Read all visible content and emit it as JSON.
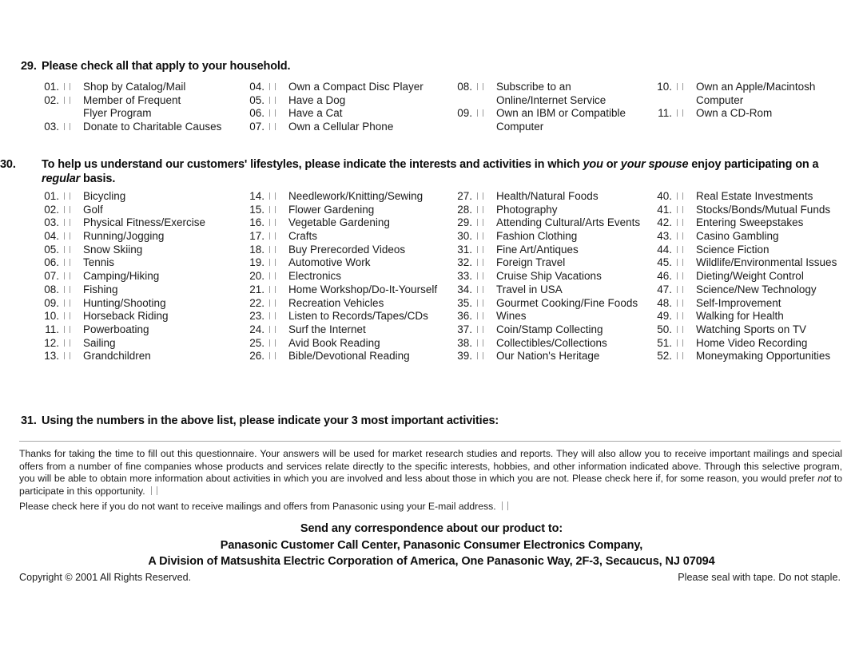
{
  "document": {
    "q29": {
      "number": "29.",
      "heading": "Please check all that apply to your household.",
      "columns": [
        {
          "items": [
            {
              "num": "01.",
              "label": "Shop by Catalog/Mail"
            },
            {
              "num": "02.",
              "label": "Member of Frequent"
            },
            {
              "num": "",
              "label": "Flyer Program",
              "continuation": true
            },
            {
              "num": "03.",
              "label": "Donate to Charitable Causes"
            }
          ]
        },
        {
          "items": [
            {
              "num": "04.",
              "label": "Own a Compact Disc Player"
            },
            {
              "num": "05.",
              "label": "Have a Dog"
            },
            {
              "num": "06.",
              "label": "Have a Cat"
            },
            {
              "num": "07.",
              "label": "Own a Cellular Phone"
            }
          ]
        },
        {
          "items": [
            {
              "num": "08.",
              "label": "Subscribe to an"
            },
            {
              "num": "",
              "label": "Online/Internet Service",
              "continuation": true
            },
            {
              "num": "09.",
              "label": "Own an IBM or Compatible"
            },
            {
              "num": "",
              "label": "Computer",
              "continuation": true
            }
          ]
        },
        {
          "items": [
            {
              "num": "10.",
              "label": "Own an Apple/Macintosh"
            },
            {
              "num": "",
              "label": "Computer",
              "continuation": true
            },
            {
              "num": "11.",
              "label": "Own a CD-Rom"
            }
          ]
        }
      ]
    },
    "q30": {
      "number": "30.",
      "heading_part1": "To help us understand our customers' lifestyles, please indicate the interests and activities in which ",
      "heading_italic1": "you",
      "heading_part2": " or ",
      "heading_italic2": "your spouse",
      "heading_part3": " enjoy participating on a ",
      "heading_italic3": "regular",
      "heading_part4": " basis.",
      "columns": [
        {
          "items": [
            {
              "num": "01.",
              "label": "Bicycling"
            },
            {
              "num": "02.",
              "label": "Golf"
            },
            {
              "num": "03.",
              "label": "Physical Fitness/Exercise"
            },
            {
              "num": "04.",
              "label": "Running/Jogging"
            },
            {
              "num": "05.",
              "label": "Snow Skiing"
            },
            {
              "num": "06.",
              "label": "Tennis"
            },
            {
              "num": "07.",
              "label": "Camping/Hiking"
            },
            {
              "num": "08.",
              "label": "Fishing"
            },
            {
              "num": "09.",
              "label": "Hunting/Shooting"
            },
            {
              "num": "10.",
              "label": "Horseback Riding"
            },
            {
              "num": "11.",
              "label": "Powerboating"
            },
            {
              "num": "12.",
              "label": "Sailing"
            },
            {
              "num": "13.",
              "label": "Grandchildren"
            }
          ]
        },
        {
          "items": [
            {
              "num": "14.",
              "label": "Needlework/Knitting/Sewing"
            },
            {
              "num": "15.",
              "label": "Flower Gardening"
            },
            {
              "num": "16.",
              "label": "Vegetable Gardening"
            },
            {
              "num": "17.",
              "label": "Crafts"
            },
            {
              "num": "18.",
              "label": "Buy Prerecorded Videos"
            },
            {
              "num": "19.",
              "label": "Automotive Work"
            },
            {
              "num": "20.",
              "label": "Electronics"
            },
            {
              "num": "21.",
              "label": "Home Workshop/Do-It-Yourself"
            },
            {
              "num": "22.",
              "label": "Recreation Vehicles"
            },
            {
              "num": "23.",
              "label": "Listen to Records/Tapes/CDs"
            },
            {
              "num": "24.",
              "label": "Surf the Internet"
            },
            {
              "num": "25.",
              "label": "Avid Book Reading"
            },
            {
              "num": "26.",
              "label": "Bible/Devotional Reading"
            }
          ]
        },
        {
          "items": [
            {
              "num": "27.",
              "label": "Health/Natural Foods"
            },
            {
              "num": "28.",
              "label": "Photography"
            },
            {
              "num": "29.",
              "label": "Attending Cultural/Arts Events"
            },
            {
              "num": "30.",
              "label": "Fashion Clothing"
            },
            {
              "num": "31.",
              "label": "Fine Art/Antiques"
            },
            {
              "num": "32.",
              "label": "Foreign Travel"
            },
            {
              "num": "33.",
              "label": "Cruise Ship Vacations"
            },
            {
              "num": "34.",
              "label": "Travel in USA"
            },
            {
              "num": "35.",
              "label": "Gourmet Cooking/Fine Foods"
            },
            {
              "num": "36.",
              "label": "Wines"
            },
            {
              "num": "37.",
              "label": "Coin/Stamp Collecting"
            },
            {
              "num": "38.",
              "label": "Collectibles/Collections"
            },
            {
              "num": "39.",
              "label": "Our Nation's Heritage"
            }
          ]
        },
        {
          "items": [
            {
              "num": "40.",
              "label": "Real Estate Investments"
            },
            {
              "num": "41.",
              "label": "Stocks/Bonds/Mutual Funds"
            },
            {
              "num": "42.",
              "label": "Entering Sweepstakes"
            },
            {
              "num": "43.",
              "label": "Casino Gambling"
            },
            {
              "num": "44.",
              "label": "Science Fiction"
            },
            {
              "num": "45.",
              "label": "Wildlife/Environmental Issues"
            },
            {
              "num": "46.",
              "label": "Dieting/Weight Control"
            },
            {
              "num": "47.",
              "label": "Science/New Technology"
            },
            {
              "num": "48.",
              "label": "Self-Improvement"
            },
            {
              "num": "49.",
              "label": "Walking for Health"
            },
            {
              "num": "50.",
              "label": "Watching Sports on TV"
            },
            {
              "num": "51.",
              "label": "Home Video Recording"
            },
            {
              "num": "52.",
              "label": "Moneymaking Opportunities"
            }
          ]
        }
      ]
    },
    "q31": {
      "number": "31.",
      "heading": "Using the numbers in the above list, please indicate your 3 most important activities:"
    },
    "thanks": {
      "part1": "Thanks for taking the time to fill out this questionnaire. Your answers will be used for market research studies and reports. They will also allow you to receive important mailings and special offers from a number of fine companies whose products and services relate directly to the specific interests, hobbies, and other information indicated above. Through this selective program, you will be able to obtain more information about activities in which you are involved and less about those in which you are not. Please check here if, for some reason, you would prefer ",
      "italic": "not",
      "part2": " to participate in this opportunity."
    },
    "email_optout": "Please check here if you do not want to receive mailings and offers from Panasonic using your E-mail address.",
    "address": {
      "line1": "Send any correspondence about our product to:",
      "line2": "Panasonic Customer Call Center, Panasonic Consumer Electronics Company,",
      "line3": "A Division of Matsushita Electric Corporation of America, One Panasonic Way, 2F-3, Secaucus, NJ 07094"
    },
    "footer": {
      "copyright": "Copyright © 2001  All Rights Reserved.",
      "seal_notice": "Please seal with tape. Do not staple."
    }
  }
}
